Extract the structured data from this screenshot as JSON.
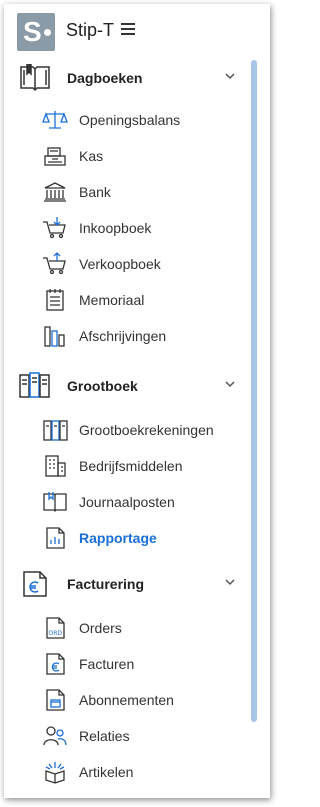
{
  "header": {
    "logo_letter": "S",
    "title": "Stip-T"
  },
  "colors": {
    "logo_bg": "#8a9aa6",
    "active_item": "#1a6fd6",
    "scrollbar": "#a8c4e8"
  },
  "nav": {
    "sections": [
      {
        "label": "Dagboeken",
        "icon": "book-icon",
        "expanded": true,
        "items": [
          {
            "label": "Openingsbalans",
            "icon": "scales-icon",
            "active": false
          },
          {
            "label": "Kas",
            "icon": "cash-register-icon",
            "active": false
          },
          {
            "label": "Bank",
            "icon": "bank-icon",
            "active": false
          },
          {
            "label": "Inkoopboek",
            "icon": "cart-in-icon",
            "active": false
          },
          {
            "label": "Verkoopboek",
            "icon": "cart-out-icon",
            "active": false
          },
          {
            "label": "Memoriaal",
            "icon": "notepad-icon",
            "active": false
          },
          {
            "label": "Afschrijvingen",
            "icon": "bars-icon",
            "active": false
          }
        ]
      },
      {
        "label": "Grootboek",
        "icon": "ledger-binders-icon",
        "expanded": true,
        "items": [
          {
            "label": "Grootboekrekeningen",
            "icon": "binders-icon",
            "active": false
          },
          {
            "label": "Bedrijfsmiddelen",
            "icon": "building-icon",
            "active": false
          },
          {
            "label": "Journaalposten",
            "icon": "journal-icon",
            "active": false
          },
          {
            "label": "Rapportage",
            "icon": "report-icon",
            "active": true
          }
        ]
      },
      {
        "label": "Facturering",
        "icon": "invoice-euro-icon",
        "expanded": true,
        "items": [
          {
            "label": "Orders",
            "icon": "order-doc-icon",
            "active": false
          },
          {
            "label": "Facturen",
            "icon": "invoice-icon",
            "active": false
          },
          {
            "label": "Abonnementen",
            "icon": "subscription-icon",
            "active": false
          },
          {
            "label": "Relaties",
            "icon": "relations-icon",
            "active": false
          },
          {
            "label": "Artikelen",
            "icon": "article-box-icon",
            "active": false
          }
        ]
      }
    ]
  }
}
